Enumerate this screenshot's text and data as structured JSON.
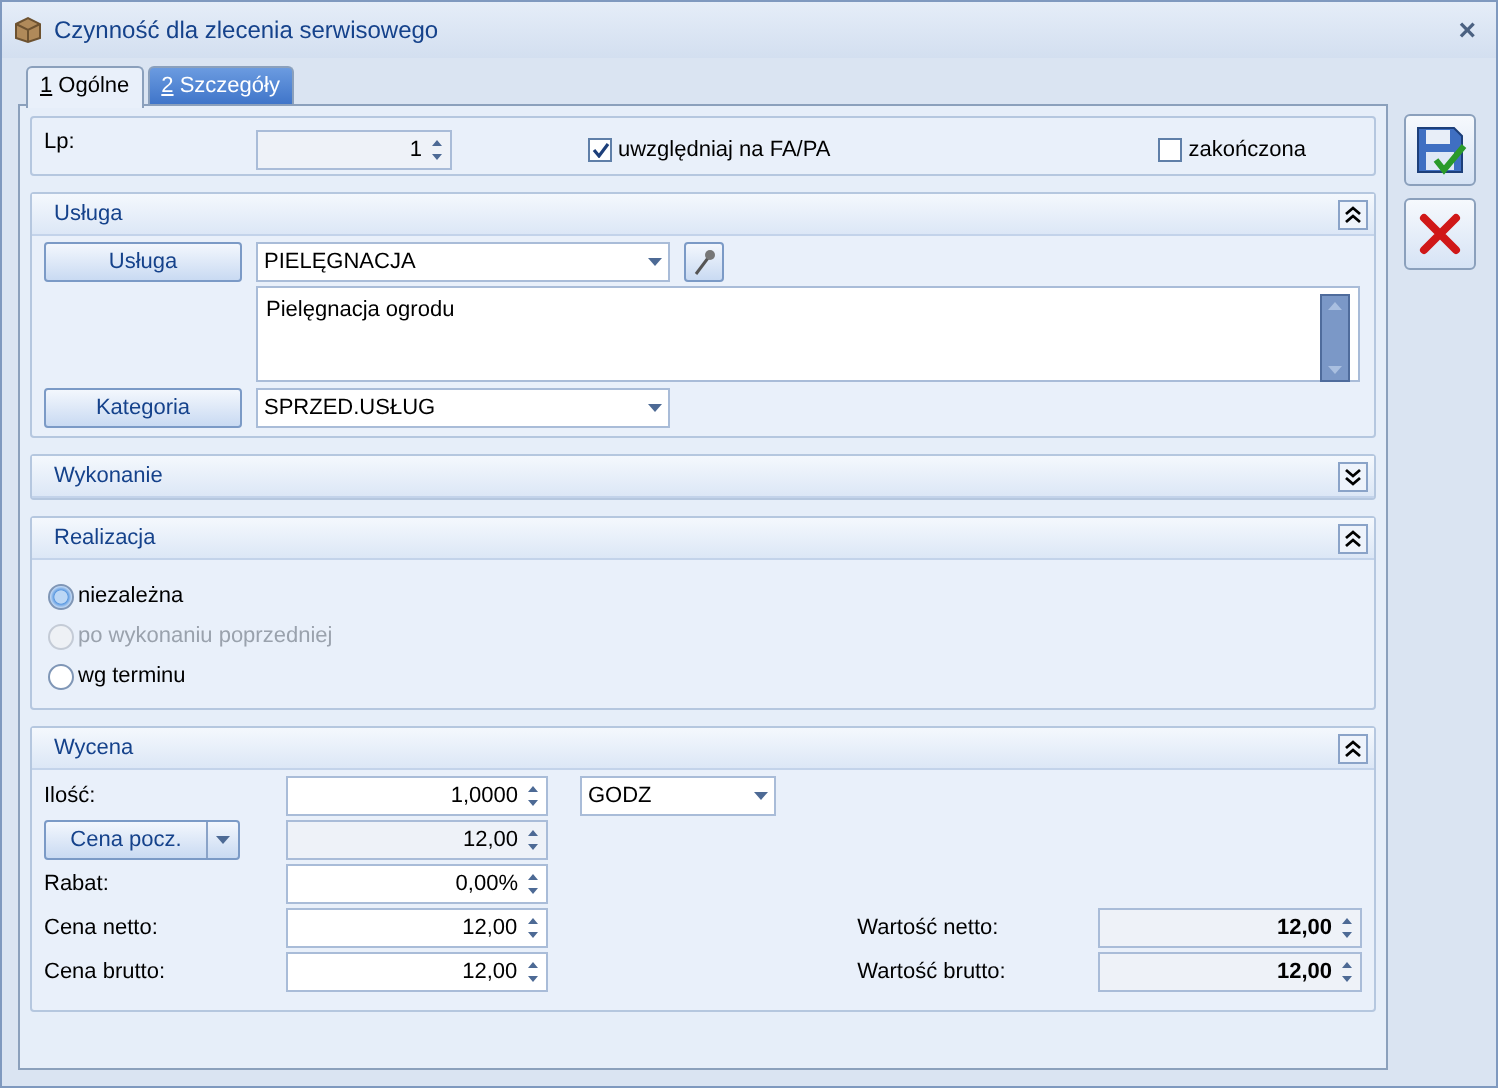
{
  "window": {
    "title": "Czynność dla zlecenia serwisowego",
    "close": "×"
  },
  "tabs": [
    {
      "label": "1 Ogólne",
      "selected": true
    },
    {
      "label": "2 Szczegóły",
      "selected": false
    }
  ],
  "header": {
    "lp_label": "Lp:",
    "lp_value": "1",
    "checkboxes": [
      {
        "label": "uwzględniaj na FA/PA",
        "checked": true
      },
      {
        "label": "zakończona",
        "checked": false
      }
    ]
  },
  "usluga": {
    "title": "Usługa",
    "expanded": true,
    "service_button": "Usługa",
    "service_value": "PIELĘGNACJA",
    "description": "Pielęgnacja ogrodu",
    "category_button": "Kategoria",
    "category_value": "SPRZED.USŁUG"
  },
  "wykonanie": {
    "title": "Wykonanie",
    "expanded": false
  },
  "realizacja": {
    "title": "Realizacja",
    "expanded": true,
    "options": [
      {
        "label": "niezależna",
        "selected": true,
        "disabled": false
      },
      {
        "label": "po wykonaniu poprzedniej",
        "selected": false,
        "disabled": true
      },
      {
        "label": "wg terminu",
        "selected": false,
        "disabled": false
      }
    ]
  },
  "wycena": {
    "title": "Wycena",
    "expanded": true,
    "rows": [
      {
        "kind": "label",
        "label": "Ilość:",
        "value": "1,0000",
        "unit": "GODZ"
      },
      {
        "kind": "dropbutton",
        "label": "Cena pocz.",
        "value": "12,00"
      },
      {
        "kind": "label",
        "label": "Rabat:",
        "value": "0,00%"
      },
      {
        "kind": "label",
        "label": "Cena netto:",
        "value": "12,00",
        "total_label": "Wartość netto:",
        "total_value": "12,00"
      },
      {
        "kind": "label",
        "label": "Cena brutto:",
        "value": "12,00",
        "total_label": "Wartość brutto:",
        "total_value": "12,00"
      }
    ]
  }
}
